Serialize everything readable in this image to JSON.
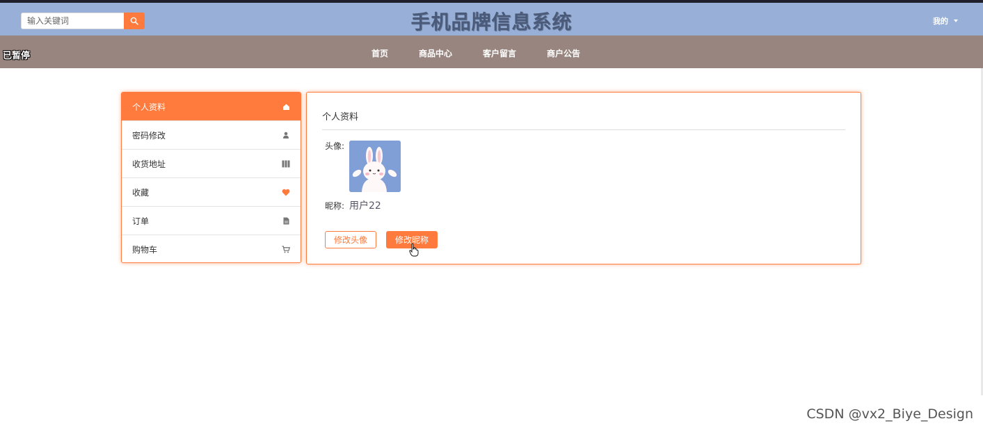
{
  "header": {
    "title": "手机品牌信息系统",
    "search_placeholder": "输入关键词",
    "user_menu_label": "我的"
  },
  "overlay": {
    "paused_text": "已暂停"
  },
  "nav": {
    "items": [
      {
        "label": "首页"
      },
      {
        "label": "商品中心"
      },
      {
        "label": "客户留言"
      },
      {
        "label": "商户公告"
      }
    ]
  },
  "sidebar": {
    "items": [
      {
        "label": "个人资料",
        "icon": "home-icon",
        "active": true
      },
      {
        "label": "密码修改",
        "icon": "user-icon",
        "active": false
      },
      {
        "label": "收货地址",
        "icon": "map-icon",
        "active": false
      },
      {
        "label": "收藏",
        "icon": "heart-icon",
        "active": false
      },
      {
        "label": "订单",
        "icon": "file-icon",
        "active": false
      },
      {
        "label": "购物车",
        "icon": "cart-icon",
        "active": false
      }
    ]
  },
  "profile": {
    "title": "个人资料",
    "avatar_label": "头像:",
    "nickname_label": "昵称:",
    "nickname_value": "用户22",
    "change_avatar_label": "修改头像",
    "change_nickname_label": "修改昵称"
  },
  "watermark": "CSDN @vx2_Biye_Design",
  "colors": {
    "accent": "#ff7a3d",
    "header_bg": "#98b0d7",
    "nav_bg": "#98857f"
  }
}
